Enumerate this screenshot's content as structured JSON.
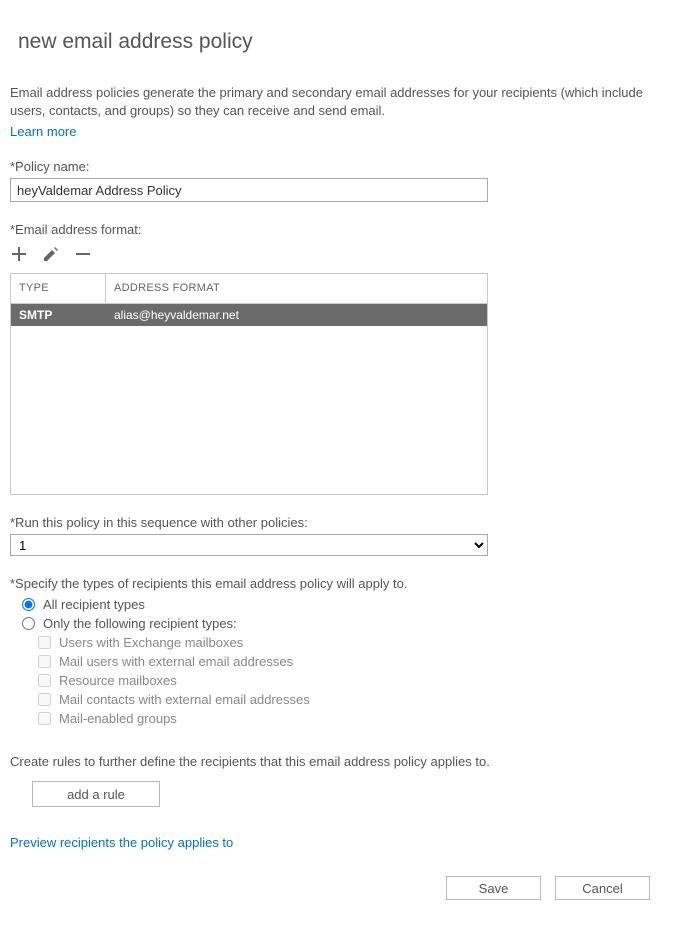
{
  "heading": "new email address policy",
  "description": {
    "line": "Email address policies generate the primary and secondary email addresses for your recipients (which include users, contacts, and groups) so they can receive and send email.",
    "learn_more": "Learn more"
  },
  "policy_name": {
    "label": "*Policy name:",
    "value": "heyValdemar Address Policy"
  },
  "email_format": {
    "label": "*Email address format:",
    "columns": {
      "type": "TYPE",
      "format": "ADDRESS FORMAT"
    },
    "rows": [
      {
        "type": "SMTP",
        "format": "alias@heyvaldemar.net"
      }
    ]
  },
  "sequence": {
    "label": "*Run this policy in this sequence with other policies:",
    "value": "1"
  },
  "recipients": {
    "label": "*Specify the types of recipients this email address policy will apply to.",
    "all": "All recipient types",
    "only": "Only the following recipient types:",
    "options": {
      "exchange": "Users with Exchange mailboxes",
      "mailusers": "Mail users with external email addresses",
      "resource": "Resource mailboxes",
      "contacts": "Mail contacts with external email addresses",
      "groups": "Mail-enabled groups"
    }
  },
  "rules": {
    "label": "Create rules to further define the recipients that this email address policy applies to.",
    "button": "add a rule"
  },
  "preview_link": "Preview recipients the policy applies to",
  "footer": {
    "save": "Save",
    "cancel": "Cancel"
  }
}
